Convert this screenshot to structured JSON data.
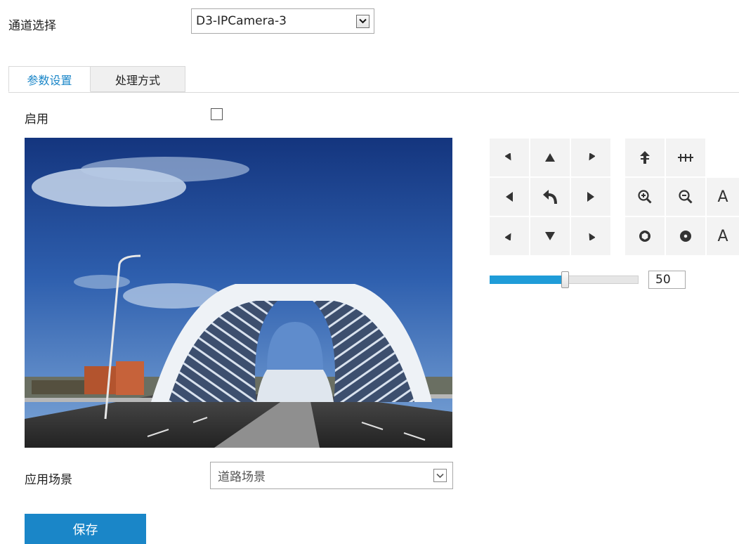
{
  "channel": {
    "label": "通道选择",
    "value": "D3-IPCamera-3"
  },
  "tabs": [
    {
      "label": "参数设置",
      "active": true
    },
    {
      "label": "处理方式",
      "active": false
    }
  ],
  "enable": {
    "label": "启用",
    "checked": false
  },
  "video": {
    "description_icon": "camera-preview"
  },
  "ptz": {
    "buttons": [
      "up-left-arrow-icon",
      "up-arrow-icon",
      "up-right-arrow-icon",
      "focus-near-icon",
      "focus-far-icon",
      "left-arrow-icon",
      "reset-return-icon",
      "right-arrow-icon",
      "zoom-in-icon",
      "zoom-out-icon",
      "down-left-arrow-icon",
      "down-arrow-icon",
      "down-right-arrow-icon",
      "iris-open-icon",
      "iris-close-icon"
    ],
    "auto_labels": [
      "A",
      "A"
    ],
    "speed": {
      "value": "50",
      "fraction": 0.5
    }
  },
  "scene": {
    "label": "应用场景",
    "value": "道路场景"
  },
  "save_label": "保存",
  "colors": {
    "accent": "#1a86c8",
    "slider": "#1f9cd8"
  }
}
